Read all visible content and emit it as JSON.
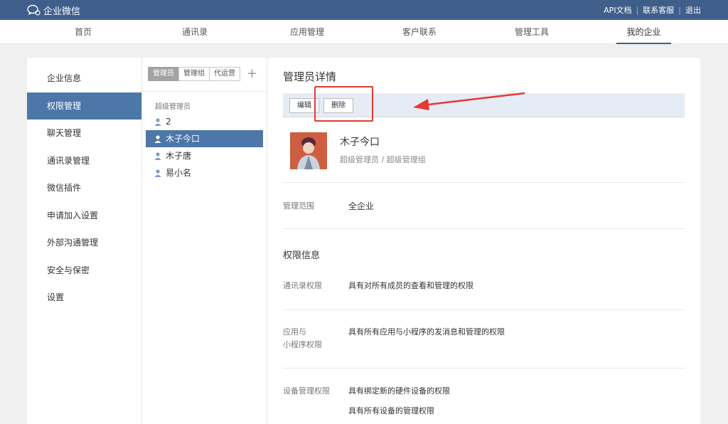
{
  "brand": {
    "name": "企业微信"
  },
  "top_links": [
    "API文档",
    "联系客服",
    "退出"
  ],
  "nav_tabs": [
    "首页",
    "通讯录",
    "应用管理",
    "客户联系",
    "管理工具",
    "我的企业"
  ],
  "left_menu": [
    "企业信息",
    "权限管理",
    "聊天管理",
    "通讯录管理",
    "微信插件",
    "申请加入设置",
    "外部沟通管理",
    "安全与保密",
    "设置"
  ],
  "segments": [
    "管理员",
    "管理组",
    "代运营"
  ],
  "plus": "+",
  "group_label": "超级管理员",
  "users": [
    "2",
    "木子今口",
    "木子唐",
    "易小名"
  ],
  "detail": {
    "title": "管理员详情",
    "edit": "编辑",
    "delete": "删除",
    "name": "木子今口",
    "role": "超级管理员 / 超级管理组",
    "scope_label": "管理范围",
    "scope_value": "全企业",
    "perm_title": "权限信息",
    "contacts_label": "通讯录权限",
    "contacts_value": "具有对所有成员的查看和管理的权限",
    "app_label_1": "应用与",
    "app_label_2": "小程序权限",
    "app_value": "具有所有应用与小程序的发消息和管理的权限",
    "device_label": "设备管理权限",
    "device_value_1": "具有绑定新的硬件设备的权限",
    "device_value_2": "具有所有设备的管理权限"
  },
  "colors": {
    "topbar": "#3f5e8a",
    "active": "#4d76a9",
    "highlight": "#e53935"
  }
}
